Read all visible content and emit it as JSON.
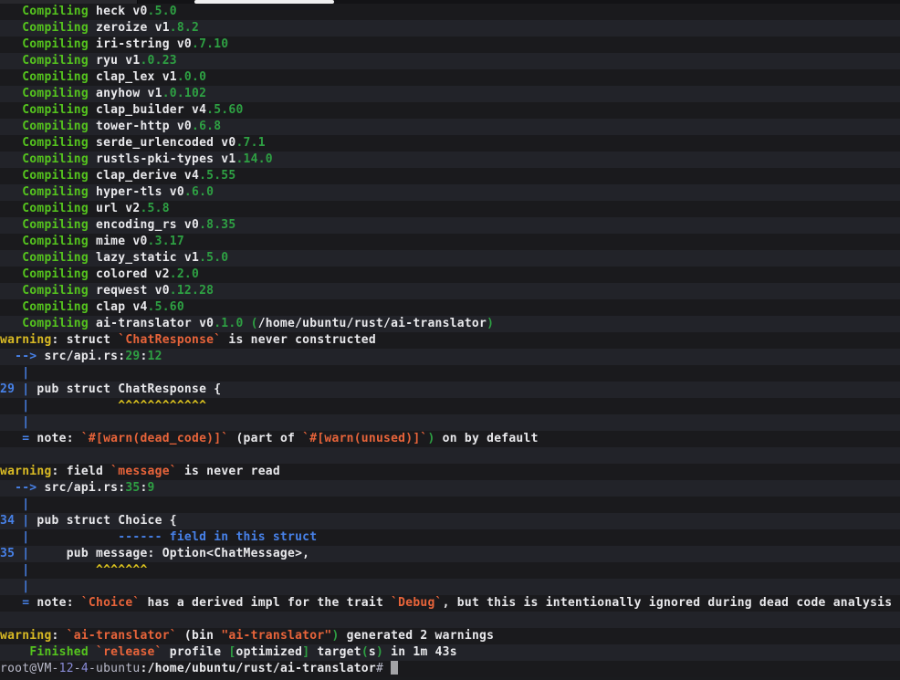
{
  "terminal": {
    "topbar": {
      "scroll_indicator_color": "#f0f0f0",
      "background": "#131316"
    },
    "colors": {
      "background_dark_row": "#1a1a1d",
      "background_light_row": "#222329",
      "bright_green": "#55c41e",
      "version_green": "#2ea043",
      "white": "#e9e9ec",
      "warning_yellow": "#d9ba24",
      "orange": "#e8643a",
      "blue": "#4781e8",
      "caret_yellow": "#ddc41e",
      "prompt_host_gray": "#babbca",
      "cursor_gray": "#a3a3a6"
    },
    "cursor_line": 40,
    "lines": [
      [
        [
          "   Compiling ",
          "g"
        ],
        [
          "heck v0",
          "w"
        ],
        [
          ".5.0",
          "vg"
        ]
      ],
      [
        [
          "   Compiling ",
          "g"
        ],
        [
          "zeroize v1",
          "w"
        ],
        [
          ".8.2",
          "vg"
        ]
      ],
      [
        [
          "   Compiling ",
          "g"
        ],
        [
          "iri-string v0",
          "w"
        ],
        [
          ".7.10",
          "vg"
        ]
      ],
      [
        [
          "   Compiling ",
          "g"
        ],
        [
          "ryu v1",
          "w"
        ],
        [
          ".0.23",
          "vg"
        ]
      ],
      [
        [
          "   Compiling ",
          "g"
        ],
        [
          "clap_lex v1",
          "w"
        ],
        [
          ".0.0",
          "vg"
        ]
      ],
      [
        [
          "   Compiling ",
          "g"
        ],
        [
          "anyhow v1",
          "w"
        ],
        [
          ".0.102",
          "vg"
        ]
      ],
      [
        [
          "   Compiling ",
          "g"
        ],
        [
          "clap_builder v4",
          "w"
        ],
        [
          ".5.60",
          "vg"
        ]
      ],
      [
        [
          "   Compiling ",
          "g"
        ],
        [
          "tower-http v0",
          "w"
        ],
        [
          ".6.8",
          "vg"
        ]
      ],
      [
        [
          "   Compiling ",
          "g"
        ],
        [
          "serde_urlencoded v0",
          "w"
        ],
        [
          ".7.1",
          "vg"
        ]
      ],
      [
        [
          "   Compiling ",
          "g"
        ],
        [
          "rustls-pki-types v1",
          "w"
        ],
        [
          ".14.0",
          "vg"
        ]
      ],
      [
        [
          "   Compiling ",
          "g"
        ],
        [
          "clap_derive v4",
          "w"
        ],
        [
          ".5.55",
          "vg"
        ]
      ],
      [
        [
          "   Compiling ",
          "g"
        ],
        [
          "hyper-tls v0",
          "w"
        ],
        [
          ".6.0",
          "vg"
        ]
      ],
      [
        [
          "   Compiling ",
          "g"
        ],
        [
          "url v2",
          "w"
        ],
        [
          ".5.8",
          "vg"
        ]
      ],
      [
        [
          "   Compiling ",
          "g"
        ],
        [
          "encoding_rs v0",
          "w"
        ],
        [
          ".8.35",
          "vg"
        ]
      ],
      [
        [
          "   Compiling ",
          "g"
        ],
        [
          "mime v0",
          "w"
        ],
        [
          ".3.17",
          "vg"
        ]
      ],
      [
        [
          "   Compiling ",
          "g"
        ],
        [
          "lazy_static v1",
          "w"
        ],
        [
          ".5.0",
          "vg"
        ]
      ],
      [
        [
          "   Compiling ",
          "g"
        ],
        [
          "colored v2",
          "w"
        ],
        [
          ".2.0",
          "vg"
        ]
      ],
      [
        [
          "   Compiling ",
          "g"
        ],
        [
          "reqwest v0",
          "w"
        ],
        [
          ".12.28",
          "vg"
        ]
      ],
      [
        [
          "   Compiling ",
          "g"
        ],
        [
          "clap v4",
          "w"
        ],
        [
          ".5.60",
          "vg"
        ]
      ],
      [
        [
          "   Compiling ",
          "g"
        ],
        [
          "ai-translator v0",
          "w"
        ],
        [
          ".1.0",
          "vg"
        ],
        [
          " ",
          "w"
        ],
        [
          "(",
          "vg"
        ],
        [
          "/home/ubuntu/rust/ai-translator",
          "w"
        ],
        [
          ")",
          "vg"
        ]
      ],
      [
        [
          "warning",
          "y"
        ],
        [
          ": struct ",
          "w"
        ],
        [
          "`ChatResponse`",
          "o"
        ],
        [
          " is never constructed",
          "w"
        ]
      ],
      [
        [
          "  ",
          "w"
        ],
        [
          "--> ",
          "b"
        ],
        [
          "src/api.rs:",
          "w"
        ],
        [
          "29",
          "vg"
        ],
        [
          ":",
          "w"
        ],
        [
          "12",
          "vg"
        ]
      ],
      [
        [
          "   ",
          "w"
        ],
        [
          "|",
          "b"
        ]
      ],
      [
        [
          "29",
          "b"
        ],
        [
          " ",
          "w"
        ],
        [
          "|",
          "b"
        ],
        [
          " pub struct ChatResponse {",
          "w"
        ]
      ],
      [
        [
          "   ",
          "w"
        ],
        [
          "|",
          "b"
        ],
        [
          "            ",
          "w"
        ],
        [
          "^^^^^^^^^^^^",
          "cy"
        ]
      ],
      [
        [
          "   ",
          "w"
        ],
        [
          "|",
          "b"
        ]
      ],
      [
        [
          "   ",
          "w"
        ],
        [
          "=",
          "b"
        ],
        [
          " note: ",
          "w"
        ],
        [
          "`#[warn(dead_code)]`",
          "o"
        ],
        [
          " (part of ",
          "w"
        ],
        [
          "`#[warn(unused)]`",
          "o"
        ],
        [
          ")",
          "vg"
        ],
        [
          " on by default",
          "w"
        ]
      ],
      [],
      [
        [
          "warning",
          "y"
        ],
        [
          ": field ",
          "w"
        ],
        [
          "`message`",
          "o"
        ],
        [
          " is never read",
          "w"
        ]
      ],
      [
        [
          "  ",
          "w"
        ],
        [
          "--> ",
          "b"
        ],
        [
          "src/api.rs:",
          "w"
        ],
        [
          "35",
          "vg"
        ],
        [
          ":",
          "w"
        ],
        [
          "9",
          "vg"
        ]
      ],
      [
        [
          "   ",
          "w"
        ],
        [
          "|",
          "b"
        ]
      ],
      [
        [
          "34",
          "b"
        ],
        [
          " ",
          "w"
        ],
        [
          "|",
          "b"
        ],
        [
          " pub struct Choice {",
          "w"
        ]
      ],
      [
        [
          "   ",
          "w"
        ],
        [
          "|",
          "b"
        ],
        [
          "            ",
          "w"
        ],
        [
          "------ field in this struct",
          "b"
        ]
      ],
      [
        [
          "35",
          "b"
        ],
        [
          " ",
          "w"
        ],
        [
          "|",
          "b"
        ],
        [
          "     pub message: Option<ChatMessage>,",
          "w"
        ]
      ],
      [
        [
          "   ",
          "w"
        ],
        [
          "|",
          "b"
        ],
        [
          "         ",
          "w"
        ],
        [
          "^^^^^^^",
          "cy"
        ]
      ],
      [
        [
          "   ",
          "w"
        ],
        [
          "|",
          "b"
        ]
      ],
      [
        [
          "   ",
          "w"
        ],
        [
          "=",
          "b"
        ],
        [
          " note: ",
          "w"
        ],
        [
          "`Choice`",
          "o"
        ],
        [
          " has a derived impl for the trait ",
          "w"
        ],
        [
          "`Debug`",
          "o"
        ],
        [
          ", but this is intentionally ignored during dead code analysis",
          "w"
        ]
      ],
      [],
      [
        [
          "warning",
          "y"
        ],
        [
          ": ",
          "w"
        ],
        [
          "`ai-translator`",
          "o"
        ],
        [
          " (bin ",
          "w"
        ],
        [
          "\"ai-translator\"",
          "o"
        ],
        [
          ")",
          "vg"
        ],
        [
          " generated 2 warnings",
          "w"
        ]
      ],
      [
        [
          "    ",
          "w"
        ],
        [
          "Finished",
          "g"
        ],
        [
          " ",
          "w"
        ],
        [
          "`release`",
          "o"
        ],
        [
          " profile ",
          "w"
        ],
        [
          "[",
          "vg"
        ],
        [
          "optimized",
          "w"
        ],
        [
          "]",
          "vg"
        ],
        [
          " target",
          "w"
        ],
        [
          "(",
          "vg"
        ],
        [
          "s",
          "w"
        ],
        [
          ")",
          "vg"
        ],
        [
          " in 1m 43s",
          "w"
        ]
      ],
      [
        [
          "root@VM-",
          "host"
        ],
        [
          "12",
          "hn"
        ],
        [
          "-",
          "host"
        ],
        [
          "4",
          "hn"
        ],
        [
          "-ubuntu",
          "host"
        ],
        [
          ":",
          "w"
        ],
        [
          "/home/ubuntu/rust/ai-translator",
          "w"
        ],
        [
          "#",
          "host"
        ],
        [
          " ",
          "w"
        ]
      ]
    ]
  }
}
